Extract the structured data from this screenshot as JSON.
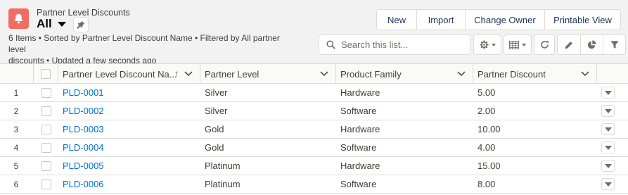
{
  "header": {
    "object_name": "Partner Level Discounts",
    "list_view": "All",
    "meta_line1": "6 Items • Sorted by Partner Level Discount Name • Filtered by All partner level",
    "meta_line2": "discounts • Updated a few seconds ago"
  },
  "actions": {
    "new": "New",
    "import": "Import",
    "change_owner": "Change Owner",
    "printable_view": "Printable View"
  },
  "search": {
    "placeholder": "Search this list..."
  },
  "toolbar_icons": [
    "gear-icon",
    "table-view-icon",
    "refresh-icon",
    "edit-icon",
    "chart-icon",
    "filter-icon"
  ],
  "columns": {
    "name": "Partner Level Discount Na...",
    "level": "Partner Level",
    "family": "Product Family",
    "discount": "Partner Discount"
  },
  "rows": [
    {
      "num": "1",
      "name": "PLD-0001",
      "level": "Silver",
      "family": "Hardware",
      "discount": "5.00"
    },
    {
      "num": "2",
      "name": "PLD-0002",
      "level": "Silver",
      "family": "Software",
      "discount": "2.00"
    },
    {
      "num": "3",
      "name": "PLD-0003",
      "level": "Gold",
      "family": "Hardware",
      "discount": "10.00"
    },
    {
      "num": "4",
      "name": "PLD-0004",
      "level": "Gold",
      "family": "Software",
      "discount": "4.00"
    },
    {
      "num": "5",
      "name": "PLD-0005",
      "level": "Platinum",
      "family": "Hardware",
      "discount": "15.00"
    },
    {
      "num": "6",
      "name": "PLD-0006",
      "level": "Platinum",
      "family": "Software",
      "discount": "8.00"
    }
  ],
  "colors": {
    "object_icon": "#ef6e64",
    "link": "#0070d2",
    "header_bg": "#f3f2f2"
  }
}
